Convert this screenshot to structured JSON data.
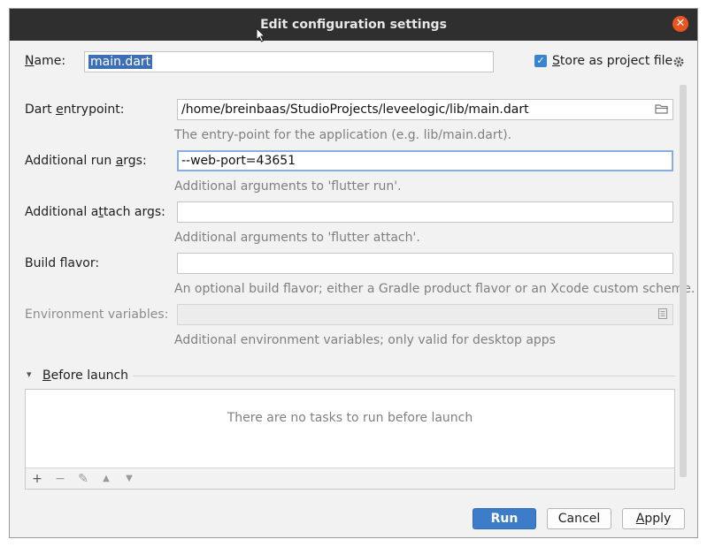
{
  "dialog": {
    "title": "Edit configuration settings",
    "close_symbol": "✕"
  },
  "name_row": {
    "label_mnemonic": "N",
    "label_rest": "ame:",
    "value": "main.dart"
  },
  "store_option": {
    "checked": true,
    "check_symbol": "✓",
    "label_mnemonic": "S",
    "label_rest": "tore as project file",
    "icon": "gear-icon"
  },
  "fields": {
    "entrypoint": {
      "label_pre": "Dart ",
      "label_mnemonic": "e",
      "label_post": "ntrypoint:",
      "value": "/home/breinbaas/StudioProjects/leveelogic/lib/main.dart",
      "hint": "The entry-point for the application (e.g. lib/main.dart).",
      "icon": "folder-icon"
    },
    "run_args": {
      "label_pre": "Additional run ",
      "label_mnemonic": "a",
      "label_post": "rgs:",
      "value": "--web-port=43651",
      "hint": "Additional arguments to 'flutter run'."
    },
    "attach_args": {
      "label_pre": "Additional a",
      "label_mnemonic": "t",
      "label_post": "tach args:",
      "value": "",
      "hint": "Additional arguments to 'flutter attach'."
    },
    "build_flavor": {
      "label": "Build flavor:",
      "value": "",
      "hint": "An optional build flavor; either a Gradle product flavor or an Xcode custom scheme."
    },
    "env_vars": {
      "label": "Environment variables:",
      "value": "",
      "hint": "Additional environment variables; only valid for desktop apps",
      "icon": "document-icon"
    }
  },
  "before_launch": {
    "expand_symbol": "▾",
    "title_mnemonic": "B",
    "title_rest": "efore launch",
    "empty_text": "There are no tasks to run before launch",
    "toolbar": {
      "add": "+",
      "remove": "−",
      "edit": "✎",
      "up": "▲",
      "down": "▼"
    }
  },
  "buttons": {
    "run": "Run",
    "cancel": "Cancel",
    "apply_mnemonic": "A",
    "apply_rest": "pply"
  },
  "colors": {
    "titlebar": "#2f2f2f",
    "close": "#e95420",
    "accent": "#3d7cc9",
    "selection": "#3d6fb5",
    "focus_border": "#87aede"
  }
}
